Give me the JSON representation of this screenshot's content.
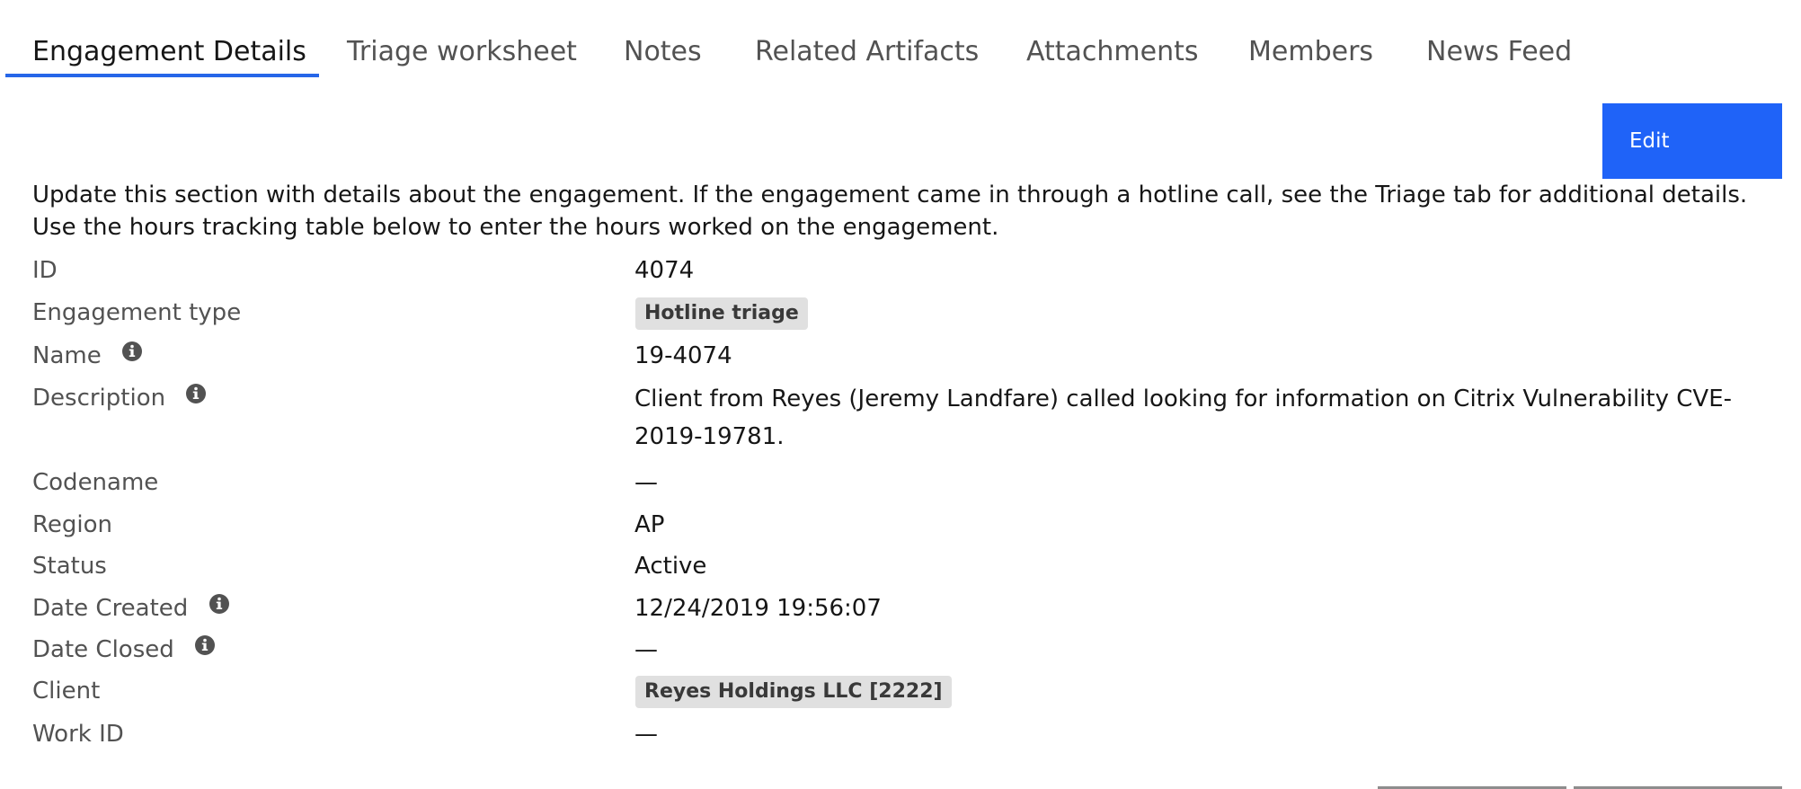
{
  "tabs": [
    {
      "label": "Engagement Details",
      "active": true
    },
    {
      "label": "Triage worksheet",
      "active": false
    },
    {
      "label": "Notes",
      "active": false
    },
    {
      "label": "Related Artifacts",
      "active": false
    },
    {
      "label": "Attachments",
      "active": false
    },
    {
      "label": "Members",
      "active": false
    },
    {
      "label": "News Feed",
      "active": false
    }
  ],
  "toolbar": {
    "edit_label": "Edit"
  },
  "intro": "Update this section with details about the engagement. If the engagement came in through a hotline call, see the Triage tab for additional details. Use the hours tracking table below to enter the hours worked on the engagement.",
  "details": {
    "id": {
      "label": "ID",
      "value": "4074"
    },
    "engagement_type": {
      "label": "Engagement type",
      "value": "Hotline triage"
    },
    "name": {
      "label": "Name",
      "value": "19-4074"
    },
    "description": {
      "label": "Description",
      "value": "Client from Reyes (Jeremy Landfare) called looking for information on Citrix Vulnerability CVE-2019-19781."
    },
    "codename": {
      "label": "Codename",
      "value": "—"
    },
    "region": {
      "label": "Region",
      "value": "AP"
    },
    "status": {
      "label": "Status",
      "value": "Active"
    },
    "date_created": {
      "label": "Date Created",
      "value": "12/24/2019 19:56:07"
    },
    "date_closed": {
      "label": "Date Closed",
      "value": "—"
    },
    "client": {
      "label": "Client",
      "value": "Reyes Holdings LLC [2222]"
    },
    "work_id": {
      "label": "Work ID",
      "value": "—"
    }
  },
  "colors": {
    "accent": "#1f63f8",
    "tab_underline": "#2666e8",
    "tag_bg": "#e0e0e0",
    "label_text": "#525252",
    "value_text": "#161616"
  },
  "icons": {
    "info": "info-circle-icon"
  }
}
